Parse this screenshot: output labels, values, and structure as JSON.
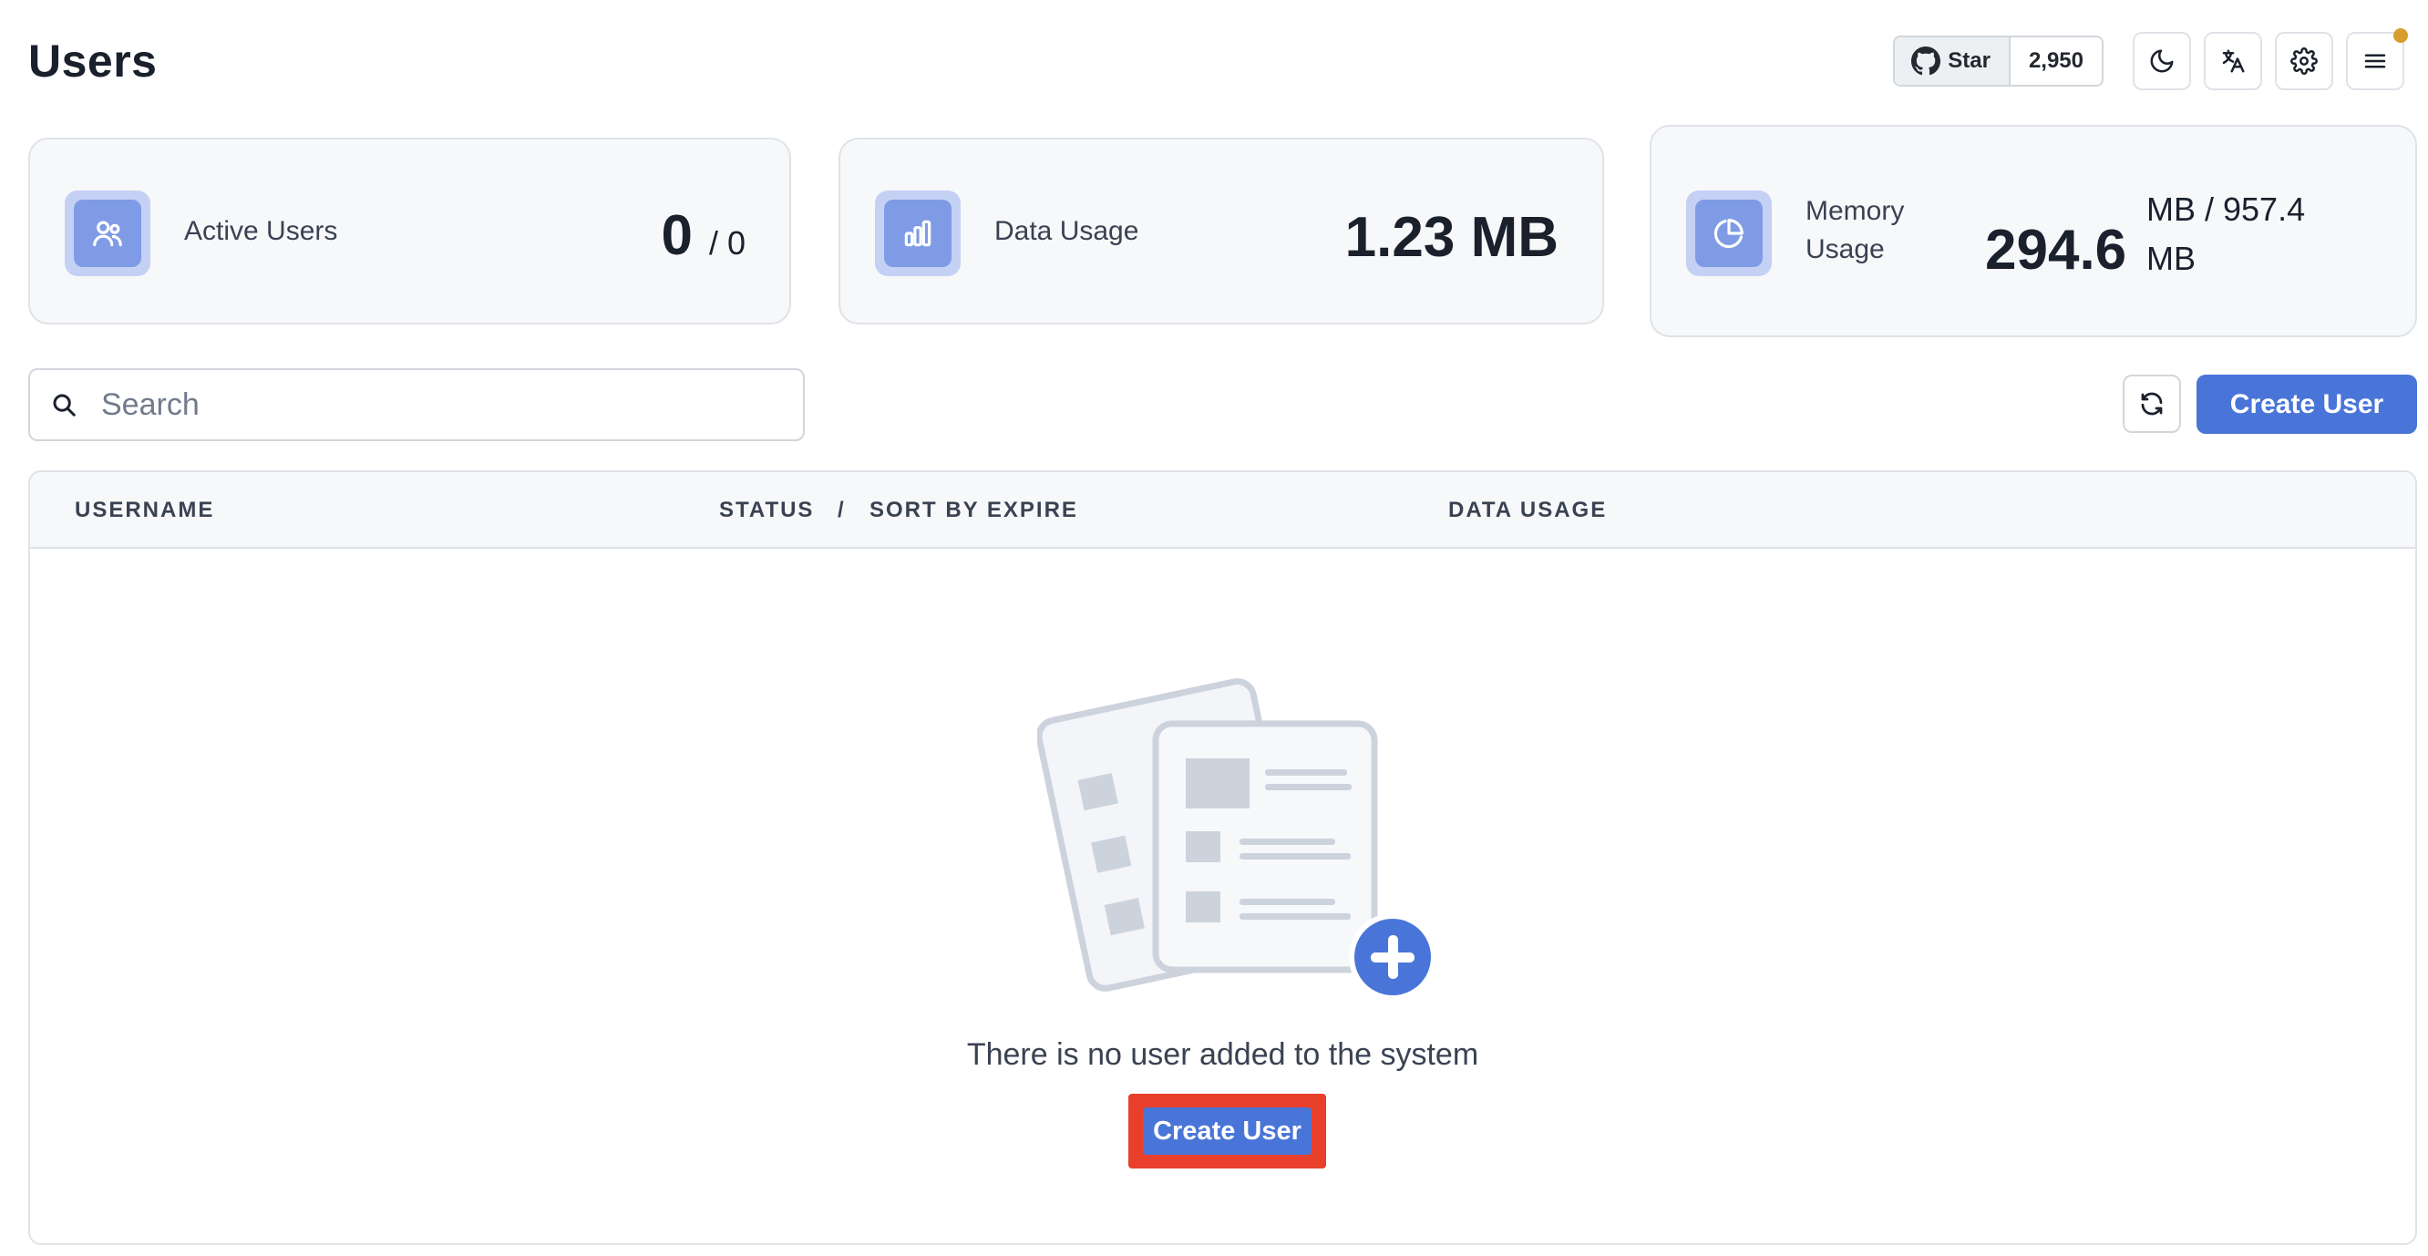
{
  "header": {
    "title": "Users",
    "github": {
      "star_label": "Star",
      "star_count": "2,950"
    },
    "icons": [
      "github-icon",
      "moon-icon",
      "translate-icon",
      "gear-icon",
      "menu-icon"
    ]
  },
  "stats": {
    "active_users": {
      "label": "Active Users",
      "value": "0",
      "total": "/ 0",
      "icon": "users-icon"
    },
    "data_usage": {
      "label": "Data Usage",
      "value": "1.23 MB",
      "icon": "bar-chart-icon"
    },
    "memory_usage": {
      "label_line1": "Memory",
      "label_line2": "Usage",
      "value": "294.6",
      "unit_line1": "MB / 957.4",
      "unit_line2": "MB",
      "icon": "pie-chart-icon"
    }
  },
  "search": {
    "placeholder": "Search",
    "value": ""
  },
  "actions": {
    "create_user_label": "Create User",
    "refresh_icon": "refresh-icon"
  },
  "table": {
    "columns": {
      "username": "USERNAME",
      "status": "STATUS",
      "separator": "/",
      "sort_by_expire": "SORT BY EXPIRE",
      "data_usage": "DATA USAGE"
    },
    "empty_message": "There is no user added to the system",
    "empty_create_label": "Create User"
  },
  "colors": {
    "primary": "#4a75d8",
    "highlight": "#e8402a",
    "notification_dot": "#d69e2e"
  }
}
